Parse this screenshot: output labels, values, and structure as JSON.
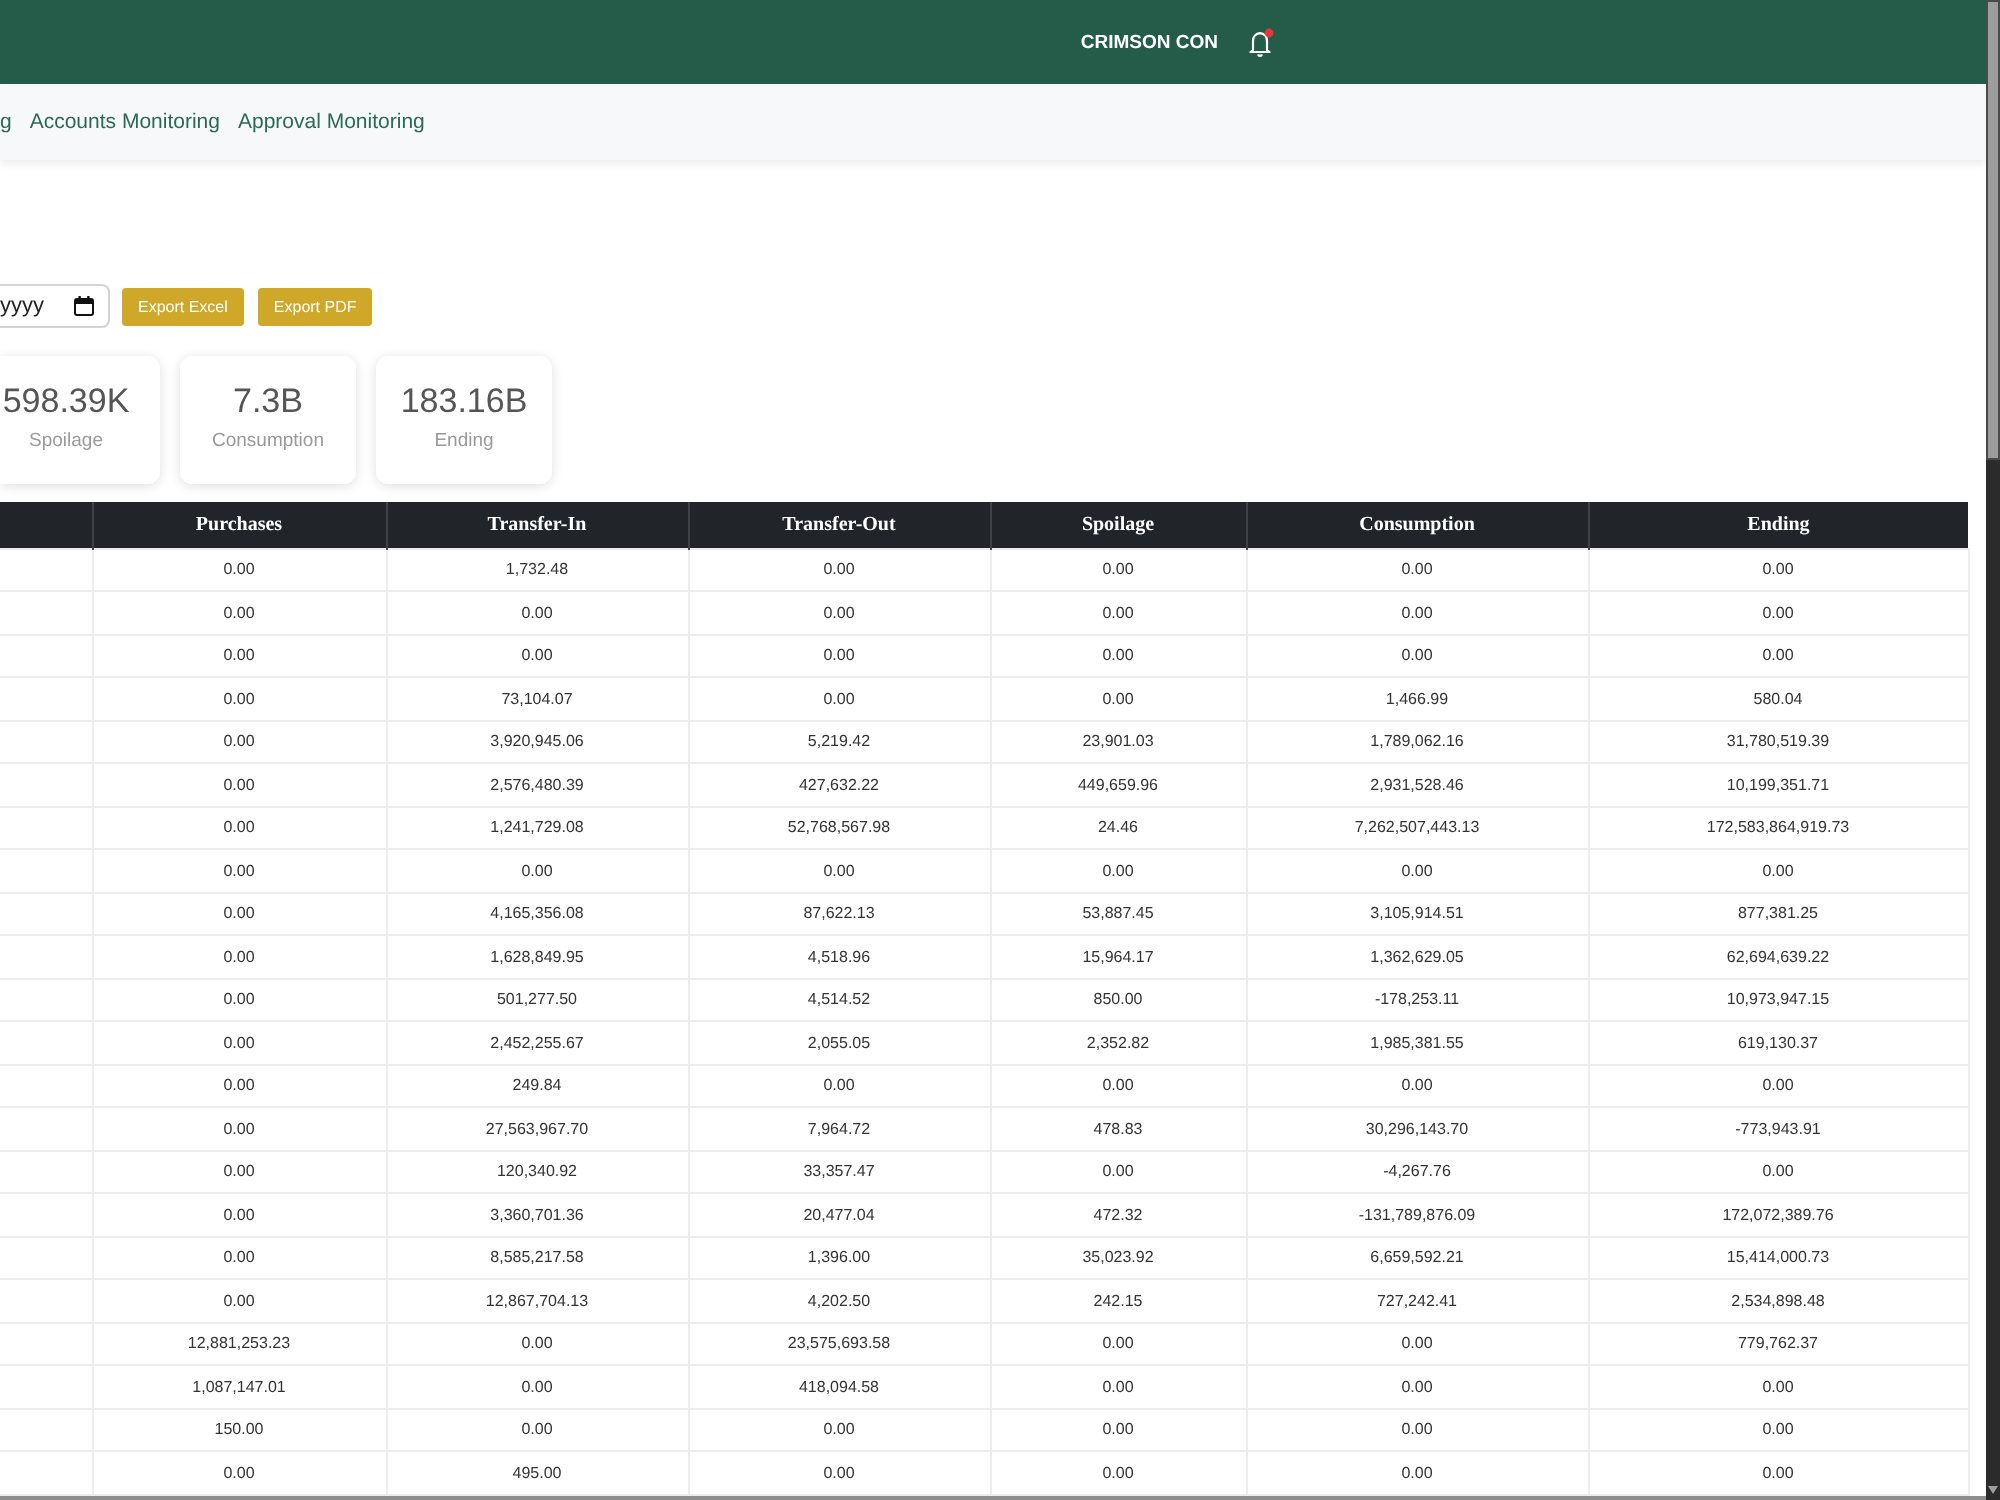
{
  "header": {
    "company": "CRIMSON CON",
    "unread_notifications": true
  },
  "nav": [
    {
      "label": "g"
    },
    {
      "label": "Accounts Monitoring"
    },
    {
      "label": "Approval Monitoring"
    }
  ],
  "filters": {
    "date_field": {
      "placeholder": "yyyy"
    },
    "buttons": [
      "Export Excel",
      "Export PDF"
    ]
  },
  "summary_cards": [
    {
      "value": "598.39K",
      "label": "Spoilage"
    },
    {
      "value": "7.3B",
      "label": "Consumption"
    },
    {
      "value": "183.16B",
      "label": "Ending"
    }
  ],
  "table": {
    "columns": [
      "Purchases",
      "Transfer-In",
      "Transfer-Out",
      "Spoilage",
      "Consumption",
      "Ending"
    ],
    "rows": [
      [
        "0.00",
        "1,732.48",
        "0.00",
        "0.00",
        "0.00",
        "0.00"
      ],
      [
        "0.00",
        "0.00",
        "0.00",
        "0.00",
        "0.00",
        "0.00"
      ],
      [
        "0.00",
        "0.00",
        "0.00",
        "0.00",
        "0.00",
        "0.00"
      ],
      [
        "0.00",
        "73,104.07",
        "0.00",
        "0.00",
        "1,466.99",
        "580.04"
      ],
      [
        "0.00",
        "3,920,945.06",
        "5,219.42",
        "23,901.03",
        "1,789,062.16",
        "31,780,519.39"
      ],
      [
        "0.00",
        "2,576,480.39",
        "427,632.22",
        "449,659.96",
        "2,931,528.46",
        "10,199,351.71"
      ],
      [
        "0.00",
        "1,241,729.08",
        "52,768,567.98",
        "24.46",
        "7,262,507,443.13",
        "172,583,864,919.73"
      ],
      [
        "0.00",
        "0.00",
        "0.00",
        "0.00",
        "0.00",
        "0.00"
      ],
      [
        "0.00",
        "4,165,356.08",
        "87,622.13",
        "53,887.45",
        "3,105,914.51",
        "877,381.25"
      ],
      [
        "0.00",
        "1,628,849.95",
        "4,518.96",
        "15,964.17",
        "1,362,629.05",
        "62,694,639.22"
      ],
      [
        "0.00",
        "501,277.50",
        "4,514.52",
        "850.00",
        "-178,253.11",
        "10,973,947.15"
      ],
      [
        "0.00",
        "2,452,255.67",
        "2,055.05",
        "2,352.82",
        "1,985,381.55",
        "619,130.37"
      ],
      [
        "0.00",
        "249.84",
        "0.00",
        "0.00",
        "0.00",
        "0.00"
      ],
      [
        "0.00",
        "27,563,967.70",
        "7,964.72",
        "478.83",
        "30,296,143.70",
        "-773,943.91"
      ],
      [
        "0.00",
        "120,340.92",
        "33,357.47",
        "0.00",
        "-4,267.76",
        "0.00"
      ],
      [
        "0.00",
        "3,360,701.36",
        "20,477.04",
        "472.32",
        "-131,789,876.09",
        "172,072,389.76"
      ],
      [
        "0.00",
        "8,585,217.58",
        "1,396.00",
        "35,023.92",
        "6,659,592.21",
        "15,414,000.73"
      ],
      [
        "0.00",
        "12,867,704.13",
        "4,202.50",
        "242.15",
        "727,242.41",
        "2,534,898.48"
      ],
      [
        "12,881,253.23",
        "0.00",
        "23,575,693.58",
        "0.00",
        "0.00",
        "779,762.37"
      ],
      [
        "1,087,147.01",
        "0.00",
        "418,094.58",
        "0.00",
        "0.00",
        "0.00"
      ],
      [
        "150.00",
        "0.00",
        "0.00",
        "0.00",
        "0.00",
        "0.00"
      ],
      [
        "0.00",
        "495.00",
        "0.00",
        "0.00",
        "0.00",
        "0.00"
      ]
    ]
  }
}
